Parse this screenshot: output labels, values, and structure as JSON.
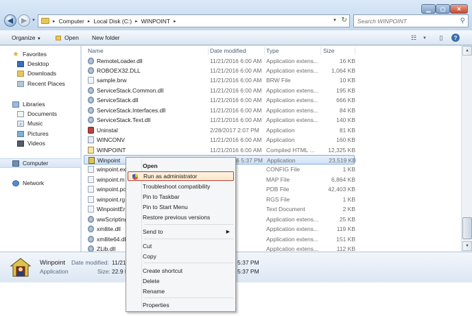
{
  "window": {
    "address": {
      "crumbs": [
        "Computer",
        "Local Disk (C:)",
        "WINPOINT"
      ]
    },
    "search_placeholder": "Search WINPOINT"
  },
  "toolbar": {
    "organize": "Organize",
    "open": "Open",
    "new_folder": "New folder"
  },
  "navpane": {
    "favorites": "Favorites",
    "desktop": "Desktop",
    "downloads": "Downloads",
    "recent_places": "Recent Places",
    "libraries": "Libraries",
    "documents": "Documents",
    "music": "Music",
    "pictures": "Pictures",
    "videos": "Videos",
    "computer": "Computer",
    "network": "Network"
  },
  "columns": {
    "name": "Name",
    "date": "Date modified",
    "type": "Type",
    "size": "Size"
  },
  "files": [
    {
      "name": "RemoteLoader.dll",
      "date": "11/21/2016 6:00 AM",
      "type": "Application extens...",
      "size": "16 KB",
      "icon": "gear"
    },
    {
      "name": "ROBOEX32.DLL",
      "date": "11/21/2016 6:00 AM",
      "type": "Application extens...",
      "size": "1,064 KB",
      "icon": "gear"
    },
    {
      "name": "sample.brw",
      "date": "11/21/2016 6:00 AM",
      "type": "BRW File",
      "size": "10 KB",
      "icon": "file"
    },
    {
      "name": "ServiceStack.Common.dll",
      "date": "11/21/2016 6:00 AM",
      "type": "Application extens...",
      "size": "195 KB",
      "icon": "gear"
    },
    {
      "name": "ServiceStack.dll",
      "date": "11/21/2016 6:00 AM",
      "type": "Application extens...",
      "size": "666 KB",
      "icon": "gear"
    },
    {
      "name": "ServiceStack.Interfaces.dll",
      "date": "11/21/2016 6:00 AM",
      "type": "Application extens...",
      "size": "84 KB",
      "icon": "gear"
    },
    {
      "name": "ServiceStack.Text.dll",
      "date": "11/21/2016 6:00 AM",
      "type": "Application extens...",
      "size": "140 KB",
      "icon": "gear"
    },
    {
      "name": "Uninstal",
      "date": "2/28/2017 2:07 PM",
      "type": "Application",
      "size": "81 KB",
      "icon": "uninstall"
    },
    {
      "name": "WINCONV",
      "date": "11/21/2016 6:00 AM",
      "type": "Application",
      "size": "160 KB",
      "icon": "app"
    },
    {
      "name": "WINPOINT",
      "date": "11/21/2016 6:00 AM",
      "type": "Compiled HTML ...",
      "size": "12,325 KB",
      "icon": "chm"
    },
    {
      "name": "Winpoint",
      "date": "11/21/2016 5:37 PM",
      "type": "Application",
      "size": "23,519 KB",
      "icon": "winpoint",
      "selected": true
    },
    {
      "name": "winpoint.ex",
      "date": "",
      "type": "CONFIG File",
      "size": "1 KB",
      "icon": "file"
    },
    {
      "name": "winpoint.m",
      "date": "",
      "type": "MAP File",
      "size": "6,864 KB",
      "icon": "file"
    },
    {
      "name": "winpoint.pc",
      "date": "",
      "type": "PDB File",
      "size": "42,403 KB",
      "icon": "file"
    },
    {
      "name": "winpoint.rg",
      "date": "",
      "type": "RGS File",
      "size": "1 KB",
      "icon": "file"
    },
    {
      "name": "WinpointErr",
      "date": "9:33 AM",
      "type": "Text Document",
      "size": "2 KB",
      "icon": "file"
    },
    {
      "name": "wwScripting",
      "date": "6:00 AM",
      "type": "Application extens...",
      "size": "25 KB",
      "icon": "gear"
    },
    {
      "name": "xmllite.dll",
      "date": "6:00 AM",
      "type": "Application extens...",
      "size": "119 KB",
      "icon": "gear"
    },
    {
      "name": "xmllite64.dl",
      "date": "6:00 AM",
      "type": "Application extens...",
      "size": "151 KB",
      "icon": "gear"
    },
    {
      "name": "ZLib.dll",
      "date": "6:00 AM",
      "type": "Application extens...",
      "size": "112 KB",
      "icon": "gear"
    }
  ],
  "details": {
    "name": "Winpoint",
    "type": "Application",
    "date_label": "Date modified:",
    "date_value": "11/21/",
    "size_label": "Size:",
    "size_value": "22.9 M",
    "date_tail": "5:37 PM",
    "date_tail2": "5:37 PM"
  },
  "context_menu": {
    "items": [
      {
        "label": "Open",
        "bold": true
      },
      {
        "label": "Run as administrator",
        "highlight": true
      },
      {
        "label": "Troubleshoot compatibility"
      },
      {
        "label": "Pin to Taskbar"
      },
      {
        "label": "Pin to Start Menu"
      },
      {
        "label": "Restore previous versions"
      },
      {
        "label": "Send to",
        "submenu": true
      },
      {
        "label": "Cut"
      },
      {
        "label": "Copy"
      },
      {
        "label": "Create shortcut"
      },
      {
        "label": "Delete"
      },
      {
        "label": "Rename"
      },
      {
        "label": "Properties"
      }
    ]
  },
  "colors": {
    "window_frame": "#c9dcef",
    "selection": "#cfe2f7",
    "menu_highlight_border": "#b8413d"
  }
}
